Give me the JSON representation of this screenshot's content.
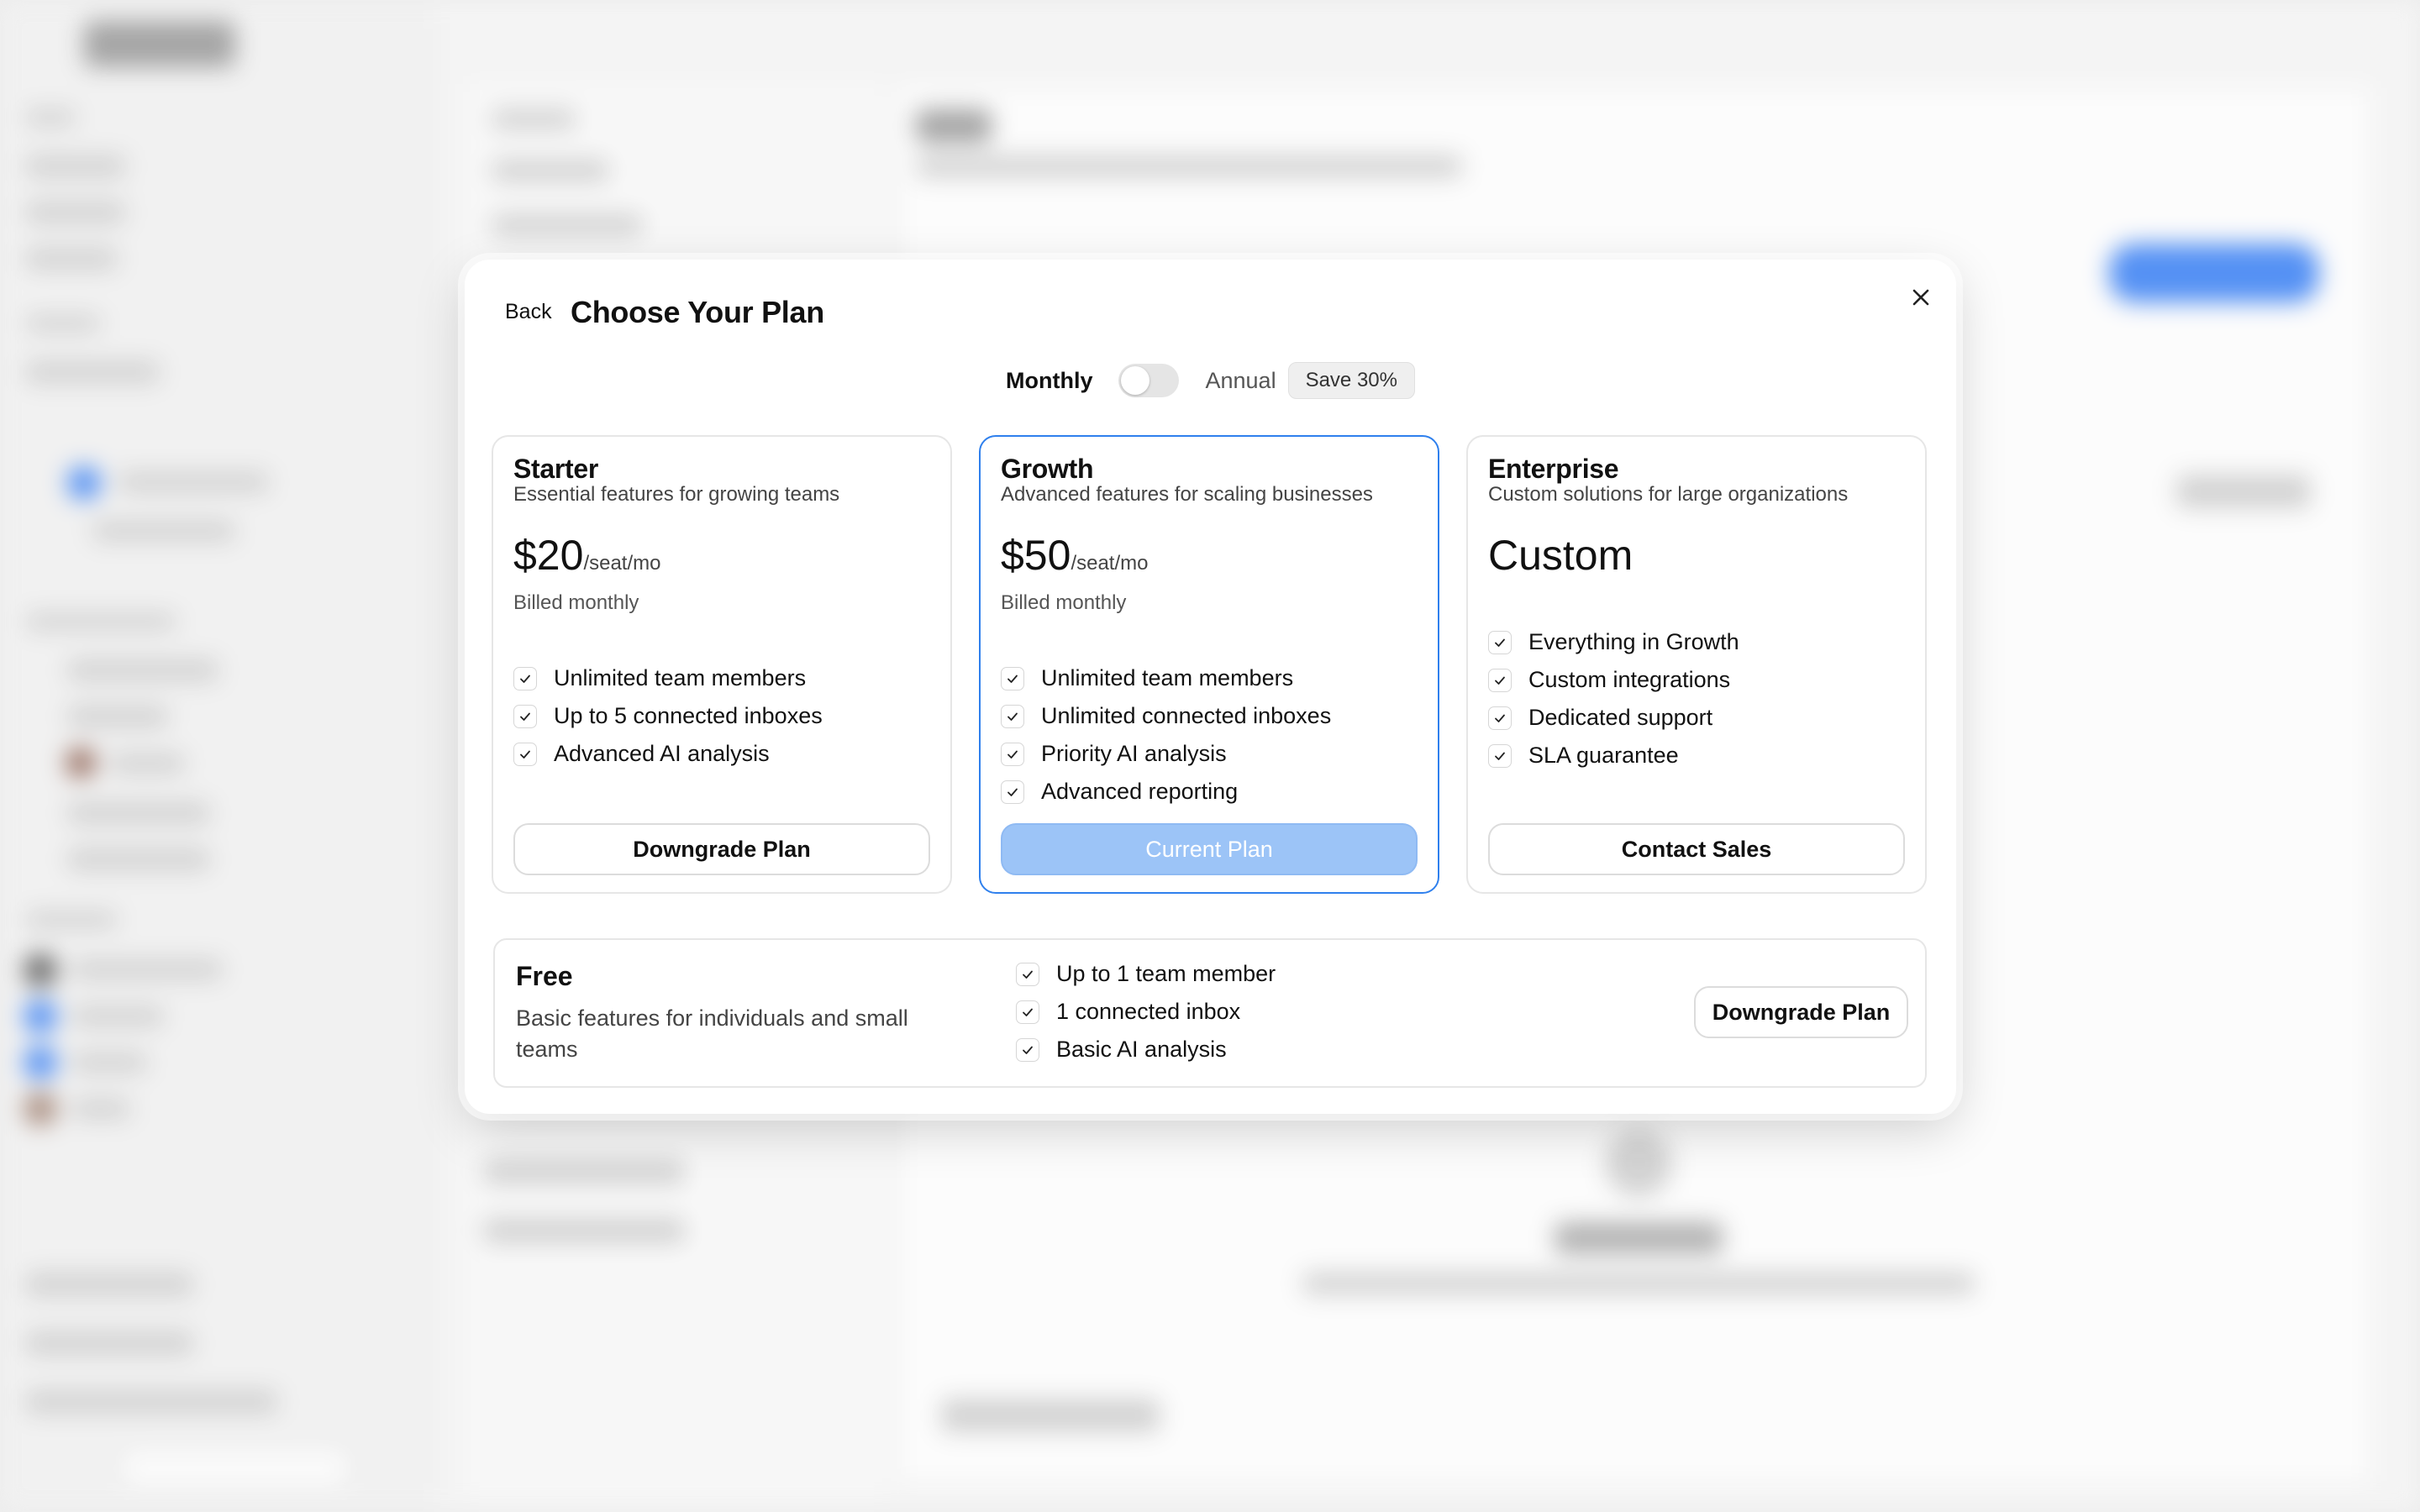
{
  "modal": {
    "back_label": "Back",
    "title": "Choose Your Plan",
    "billing_toggle": {
      "monthly_label": "Monthly",
      "annual_label": "Annual",
      "save_badge": "Save 30%",
      "selected": "Monthly"
    },
    "plans": [
      {
        "name": "Starter",
        "description": "Essential features for growing teams",
        "price": "$20",
        "price_unit": "/seat/mo",
        "billing_note": "Billed monthly",
        "features": [
          "Unlimited team members",
          "Up to 5 connected inboxes",
          "Advanced AI analysis"
        ],
        "button_label": "Downgrade Plan"
      },
      {
        "name": "Growth",
        "description": "Advanced features for scaling businesses",
        "price": "$50",
        "price_unit": "/seat/mo",
        "billing_note": "Billed monthly",
        "features": [
          "Unlimited team members",
          "Unlimited connected inboxes",
          "Priority AI analysis",
          "Advanced reporting"
        ],
        "button_label": "Current Plan",
        "is_current": true
      },
      {
        "name": "Enterprise",
        "description": "Custom solutions for large organizations",
        "price": "Custom",
        "features": [
          "Everything in Growth",
          "Custom integrations",
          "Dedicated support",
          "SLA guarantee"
        ],
        "button_label": "Contact Sales"
      }
    ],
    "free_plan": {
      "name": "Free",
      "description": "Basic features for individuals and small teams",
      "features": [
        "Up to 1 team member",
        "1 connected inbox",
        "Basic AI analysis"
      ],
      "button_label": "Downgrade Plan"
    }
  },
  "icons": {
    "close": "close-icon",
    "check": "check-icon"
  },
  "colors": {
    "accent": "#2f80ed",
    "current_plan_button": "#9cc4f7",
    "blurred_primary_button": "#3b82f6"
  }
}
